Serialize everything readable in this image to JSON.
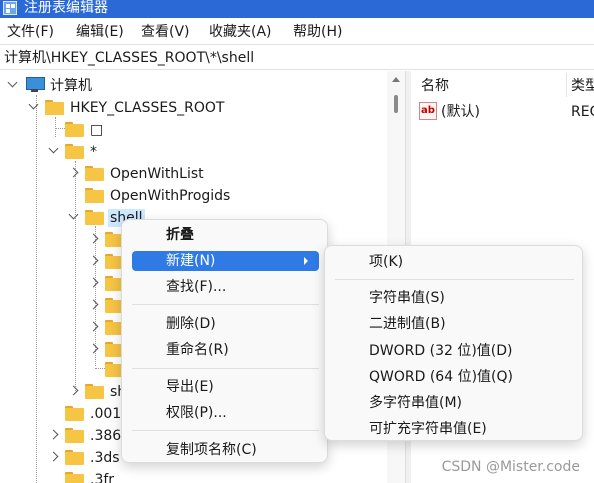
{
  "window": {
    "title": "注册表编辑器"
  },
  "menubar": [
    "文件(F)",
    "编辑(E)",
    "查看(V)",
    "收藏夹(A)",
    "帮助(H)"
  ],
  "address": "计算机\\HKEY_CLASSES_ROOT\\*\\shell",
  "tree": {
    "computer": "计算机",
    "root": "HKEY_CLASSES_ROOT",
    "empty_key": "□",
    "star": "*",
    "open_with_list": "OpenWithList",
    "open_with_progids": "OpenWithProgids",
    "shell": "shell",
    "shell_sibling": "sh",
    "ext_001": ".001",
    "ext_386": ".386",
    "ext_3ds": ".3ds",
    "ext_3fr": ".3fr"
  },
  "list": {
    "headers": {
      "name": "名称",
      "type": "类型"
    },
    "rows": [
      {
        "name": "(默认)",
        "type": "REG",
        "icon": "ab-string-value-icon"
      }
    ]
  },
  "context_menu": {
    "collapse": "折叠",
    "new": "新建(N)",
    "find": "查找(F)...",
    "delete": "删除(D)",
    "rename": "重命名(R)",
    "export": "导出(E)",
    "permissions": "权限(P)...",
    "copy_key_name": "复制项名称(C)"
  },
  "submenu": {
    "key": "项(K)",
    "string": "字符串值(S)",
    "binary": "二进制值(B)",
    "dword": "DWORD (32 位)值(D)",
    "qword": "QWORD (64 位)值(Q)",
    "multi_string": "多字符串值(M)",
    "expandable_string": "可扩充字符串值(E)"
  },
  "watermark": "CSDN @Mister.code",
  "colors": {
    "titlebar": "#2b6ad6",
    "menu_highlight": "#2f7ae5",
    "selection": "#cde8ff",
    "folder": "#f6c543"
  }
}
